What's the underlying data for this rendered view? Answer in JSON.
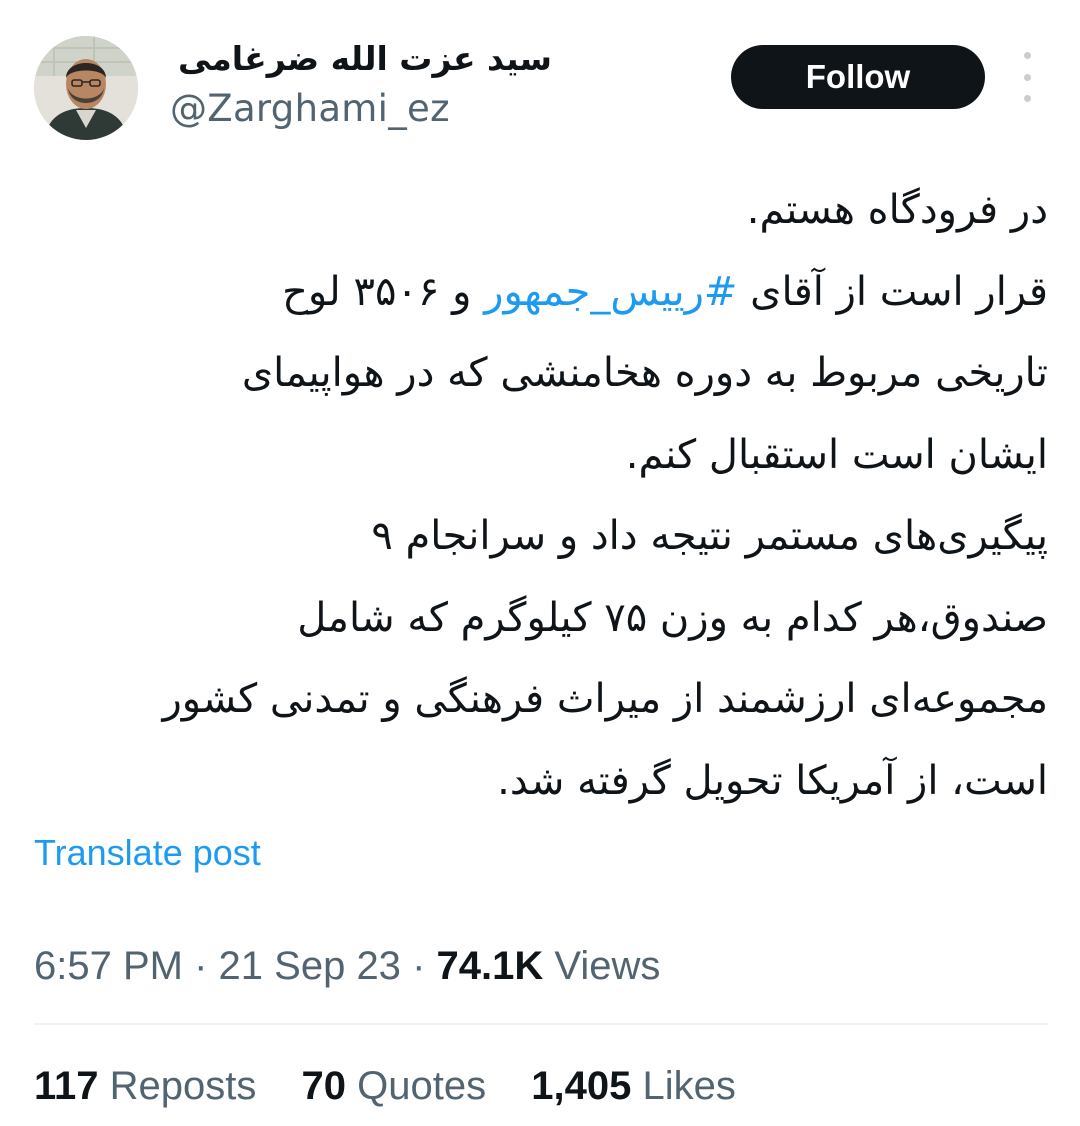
{
  "author": {
    "display_name": "سید عزت الله ضرغامی",
    "handle": "@Zarghami_ez"
  },
  "follow_label": "Follow",
  "more_icon": "more-vertical-icon",
  "tweet": {
    "lines": [
      {
        "text": "در فرودگاه هستم."
      },
      {
        "before": "قرار است از آقای ",
        "hashtag": "#رییس_جمهور",
        "after": " و ۳۵۰۶ لوح"
      },
      {
        "text": "تاریخی مربوط به دوره هخامنشی که در هواپیمای"
      },
      {
        "text": "ایشان است استقبال کنم."
      },
      {
        "text": "پیگیری‌های مستمر نتیجه داد و سرانجام ۹"
      },
      {
        "text": "صندوق،هر کدام به وزن ۷۵ کیلوگرم که شامل"
      },
      {
        "text": "مجموعه‌ای ارزشمند از میراث فرهنگی و تمدنی کشور"
      },
      {
        "text": "است، از آمریکا تحویل گرفته شد."
      }
    ]
  },
  "translate_label": "Translate post",
  "meta": {
    "time": "6:57 PM",
    "separator": "·",
    "date": "21 Sep 23",
    "views_count": "74.1K",
    "views_label": "Views"
  },
  "stats": {
    "reposts_count": "117",
    "reposts_label": "Reposts",
    "quotes_count": "70",
    "quotes_label": "Quotes",
    "likes_count": "1,405",
    "likes_label": "Likes"
  },
  "colors": {
    "link": "#1d9bf0",
    "text_primary": "#0f1419",
    "text_secondary": "#536471",
    "follow_bg": "#0f1419"
  }
}
